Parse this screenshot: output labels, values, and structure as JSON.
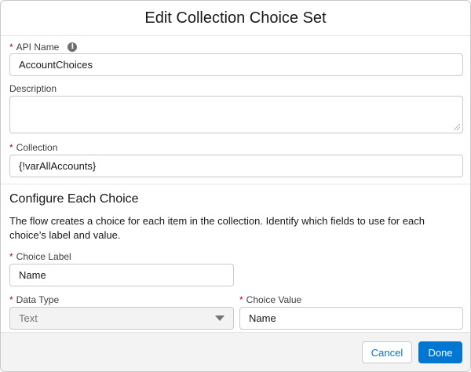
{
  "modal": {
    "title": "Edit Collection Choice Set",
    "required_marker": "*"
  },
  "fields": {
    "api_name": {
      "label": "API Name",
      "value": "AccountChoices",
      "info_glyph": "i"
    },
    "description": {
      "label": "Description",
      "value": ""
    },
    "collection": {
      "label": "Collection",
      "value": "{!varAllAccounts}"
    }
  },
  "configure": {
    "title": "Configure Each Choice",
    "help": "The flow creates a choice for each item in the collection. Identify which fields to use for each choice’s label and value.",
    "choice_label": {
      "label": "Choice Label",
      "value": "Name"
    },
    "data_type": {
      "label": "Data Type",
      "value": "Text"
    },
    "choice_value": {
      "label": "Choice Value",
      "value": "Name"
    }
  },
  "footer": {
    "cancel_label": "Cancel",
    "done_label": "Done"
  },
  "colors": {
    "brand": "#0176d3",
    "required": "#ba0517",
    "border": "#c9c9c9",
    "footer_bg": "#f3f3f3"
  }
}
